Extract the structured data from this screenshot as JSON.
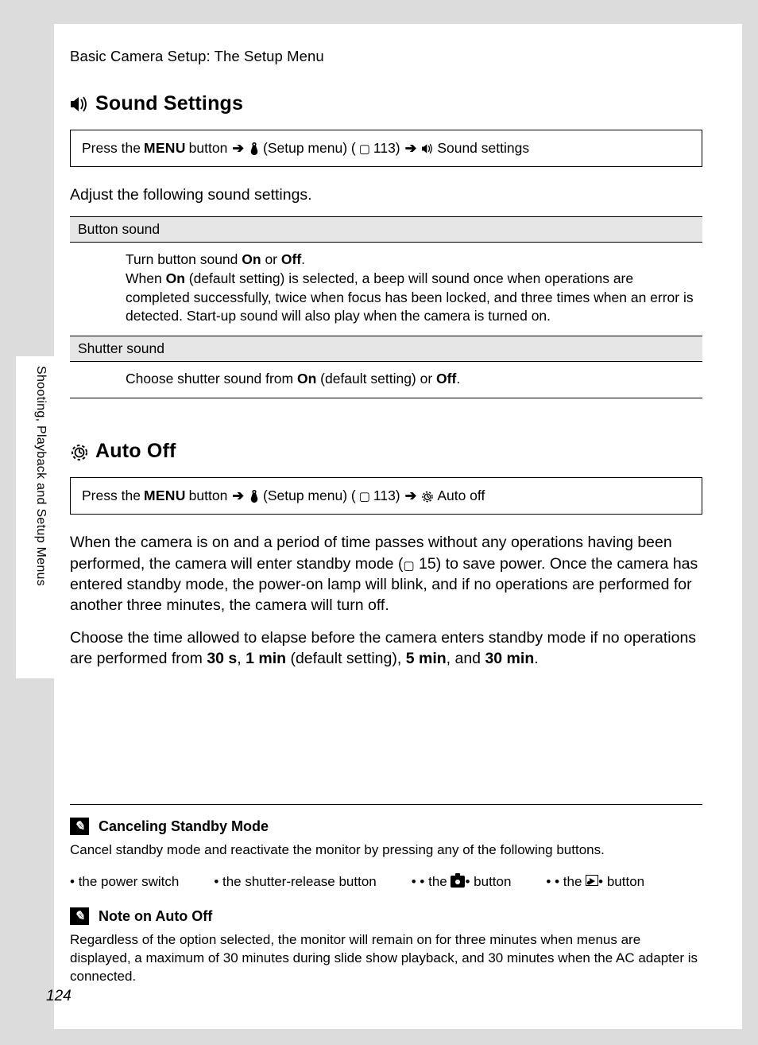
{
  "running_head": "Basic Camera Setup: The Setup Menu",
  "sidebar_label": "Shooting, Playback and Setup Menus",
  "page_number": "124",
  "sound": {
    "title": "Sound Settings",
    "nav_prefix": "Press the ",
    "nav_menu": "MENU",
    "nav_button": " button ",
    "nav_setup": " (Setup menu) (",
    "nav_pageref": " 113) ",
    "nav_end": " Sound settings",
    "intro": "Adjust the following sound settings.",
    "row1_hdr": "Button sound",
    "row1_pre": "Turn button sound ",
    "row1_on": "On",
    "row1_or": " or ",
    "row1_off": "Off",
    "row1_period": ".",
    "row1_line2a": "When ",
    "row1_line2b": "On",
    "row1_line2c": " (default setting) is selected, a beep will sound once when operations are completed successfully, twice when focus has been locked, and three times when an error is detected. Start-up sound will also play when the camera is turned on.",
    "row2_hdr": "Shutter sound",
    "row2_a": "Choose shutter sound from ",
    "row2_on": "On",
    "row2_b": " (default setting) or ",
    "row2_off": "Off",
    "row2_c": "."
  },
  "autooff": {
    "title": "Auto Off",
    "nav_prefix": "Press the ",
    "nav_menu": "MENU",
    "nav_button": " button ",
    "nav_setup": " (Setup menu) (",
    "nav_pageref": " 113) ",
    "nav_end": " Auto off",
    "para1a": "When the camera is on and a period of time passes without any operations having been performed, the camera will enter standby mode (",
    "para1_ref": " 15) to save power.",
    "para1b": "Once the camera has entered standby mode, the power-on lamp will blink, and if no operations are performed for another three minutes, the camera will turn off.",
    "para2a": "Choose the time allowed to elapse before the camera enters standby mode if no operations are performed from ",
    "opt1": "30 s",
    "c1": ", ",
    "opt2": "1 min",
    "c2": " (default setting), ",
    "opt3": "5 min",
    "c3": ", and ",
    "opt4": "30 min",
    "c4": "."
  },
  "note1": {
    "title": "Canceling Standby Mode",
    "body": "Cancel standby mode and reactivate the monitor by pressing any of the following buttons.",
    "b1": "the power switch",
    "b2": "the shutter-release button",
    "b3_pre": "the ",
    "b3_post": " button",
    "b4_pre": "the ",
    "b4_post": " button"
  },
  "note2": {
    "title": "Note on Auto Off",
    "body": "Regardless of the option selected, the monitor will remain on for three minutes when menus are displayed, a maximum of 30 minutes during slide show playback, and 30 minutes when the AC adapter is connected."
  }
}
